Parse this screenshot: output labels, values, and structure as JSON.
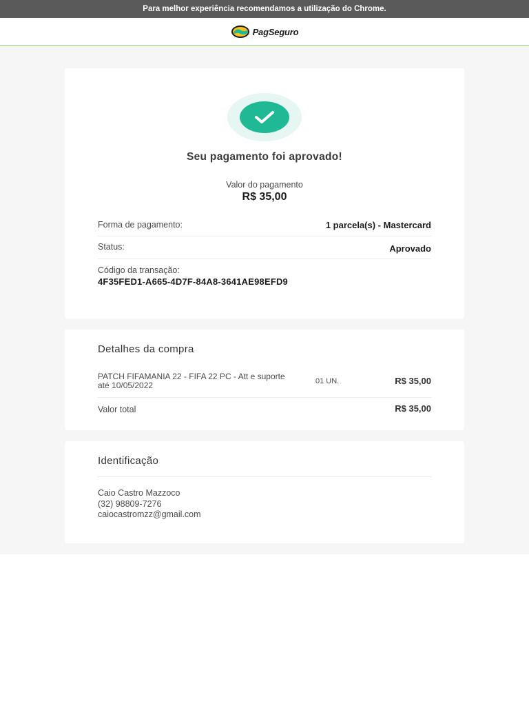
{
  "topbar": {
    "message": "Para melhor experiência recomendamos a utilização do Chrome."
  },
  "header": {
    "brand": "PagSeguro",
    "logo_icon": "pagseguro-logo-icon"
  },
  "status_card": {
    "icon": "check-icon",
    "title": "Seu pagamento foi aprovado!",
    "amount_label": "Valor do pagamento",
    "amount_value": "R$ 35,00",
    "payment_method_label": "Forma de pagamento:",
    "payment_method_value": "1 parcela(s) - Mastercard",
    "status_label": "Status:",
    "status_value": "Aprovado",
    "transaction_label": "Código da transação:",
    "transaction_code": "4F35FED1-A665-4D7F-84A8-3641AE98EFD9"
  },
  "details_card": {
    "title": "Detalhes da compra",
    "item": {
      "name": "PATCH FIFAMANIA 22 - FIFA 22 PC - Att e suporte até 10/05/2022",
      "quantity": "01 UN.",
      "price": "R$ 35,00"
    },
    "total_label": "Valor total",
    "total_value": "R$ 35,00"
  },
  "identification_card": {
    "title": "Identificação",
    "name": "Caio Castro Mazzoco",
    "phone": "(32) 98809-7276",
    "email": "caiocastromzz@gmail.com"
  },
  "colors": {
    "topbar_bg": "#5a5a5a",
    "accent_green": "#1fb995",
    "header_border": "#8fc96f",
    "page_bg": "#f6f6f6"
  }
}
